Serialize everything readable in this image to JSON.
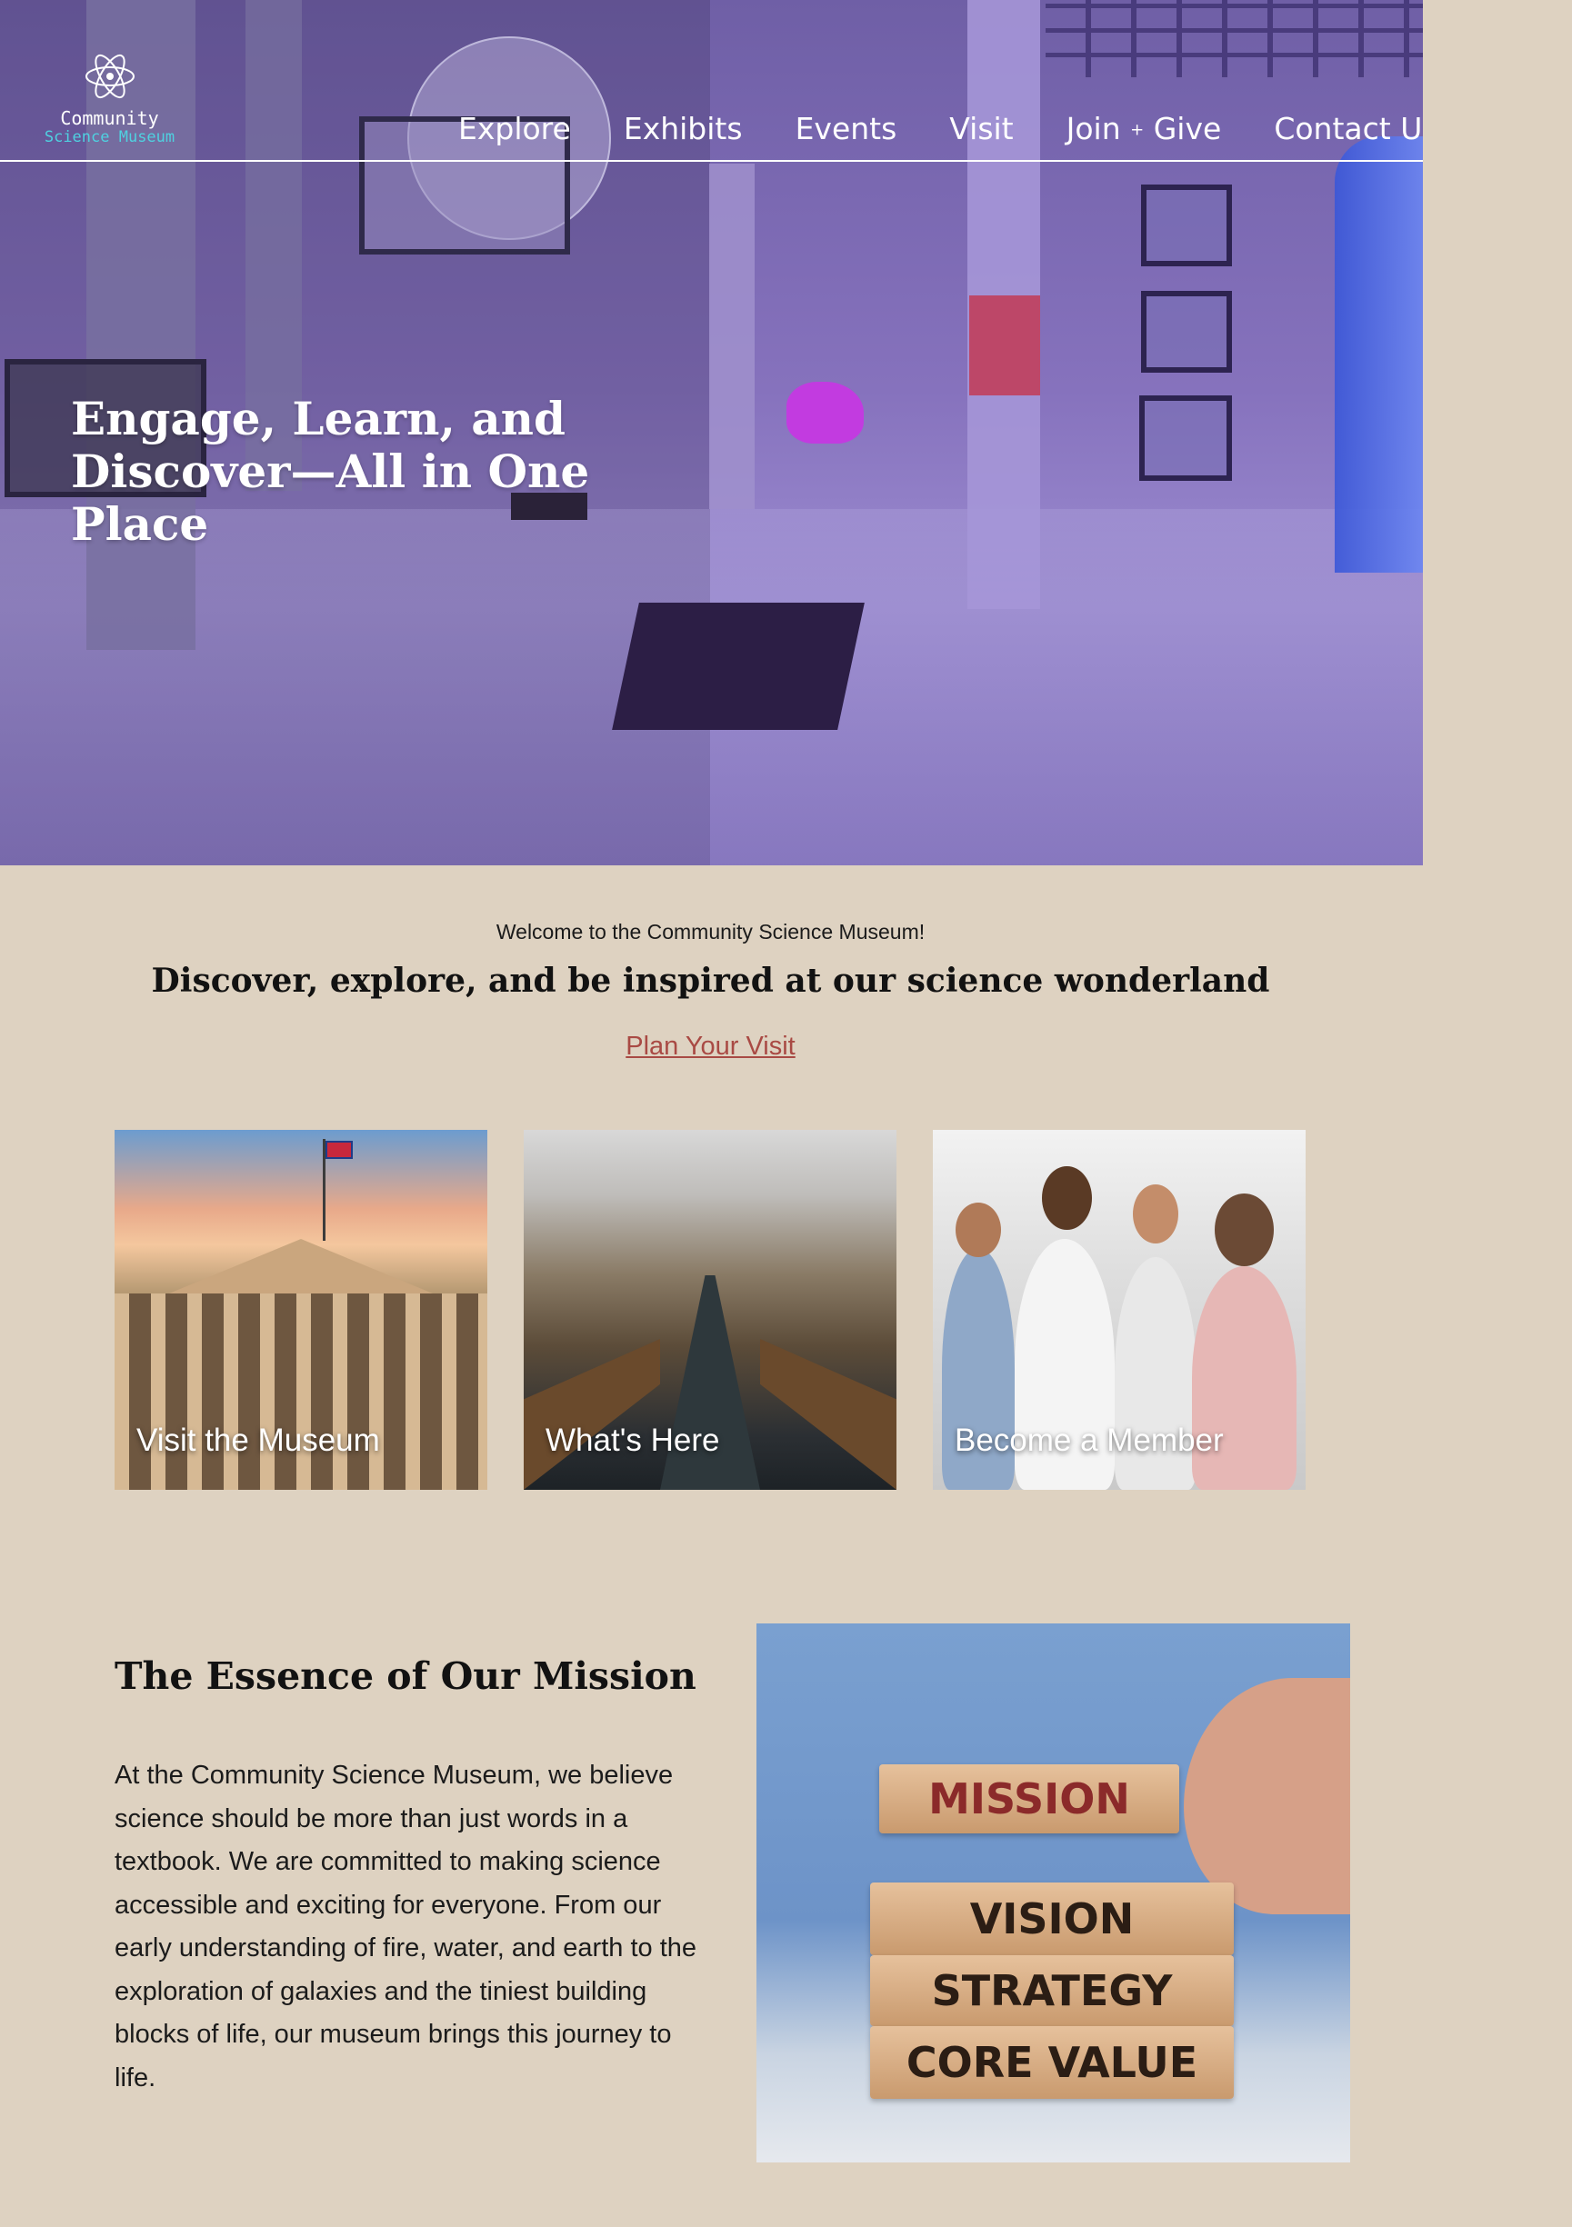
{
  "brand": {
    "line1": "Community",
    "line2": "Science Museum",
    "accent_color": "#4fd1e0"
  },
  "nav": {
    "items": [
      {
        "label": "Explore"
      },
      {
        "label": "Exhibits"
      },
      {
        "label": "Events"
      },
      {
        "label": "Visit"
      },
      {
        "label": "Join",
        "plus": "+",
        "suffix": "Give"
      },
      {
        "label": "Contact Us"
      }
    ]
  },
  "hero": {
    "title": "Engage, Learn, and Discover—All in One Place",
    "icon": "atom-icon",
    "overlay_color": "#7a66b8"
  },
  "intro": {
    "welcome": "Welcome to the Community Science Museum!",
    "tagline": "Discover, explore, and be inspired at our science wonderland",
    "cta": "Plan Your Visit",
    "cta_color": "#a94a44"
  },
  "cards": [
    {
      "caption": "Visit the Museum"
    },
    {
      "caption": "What's Here"
    },
    {
      "caption": "Become a Member"
    }
  ],
  "mission": {
    "title": "The Essence of Our Mission",
    "body": "At the Community Science Museum, we believe science should be more than just words in a textbook. We are committed to making science accessible and exciting for everyone. From our early understanding of fire, water, and earth to the exploration of galaxies and the tiniest building blocks of life, our museum brings this journey to life.",
    "image_blocks": [
      "MISSION",
      "VISION",
      "STRATEGY",
      "CORE VALUE"
    ]
  },
  "colors": {
    "page_bg": "#ded2c1",
    "text": "#1b1b1b"
  }
}
